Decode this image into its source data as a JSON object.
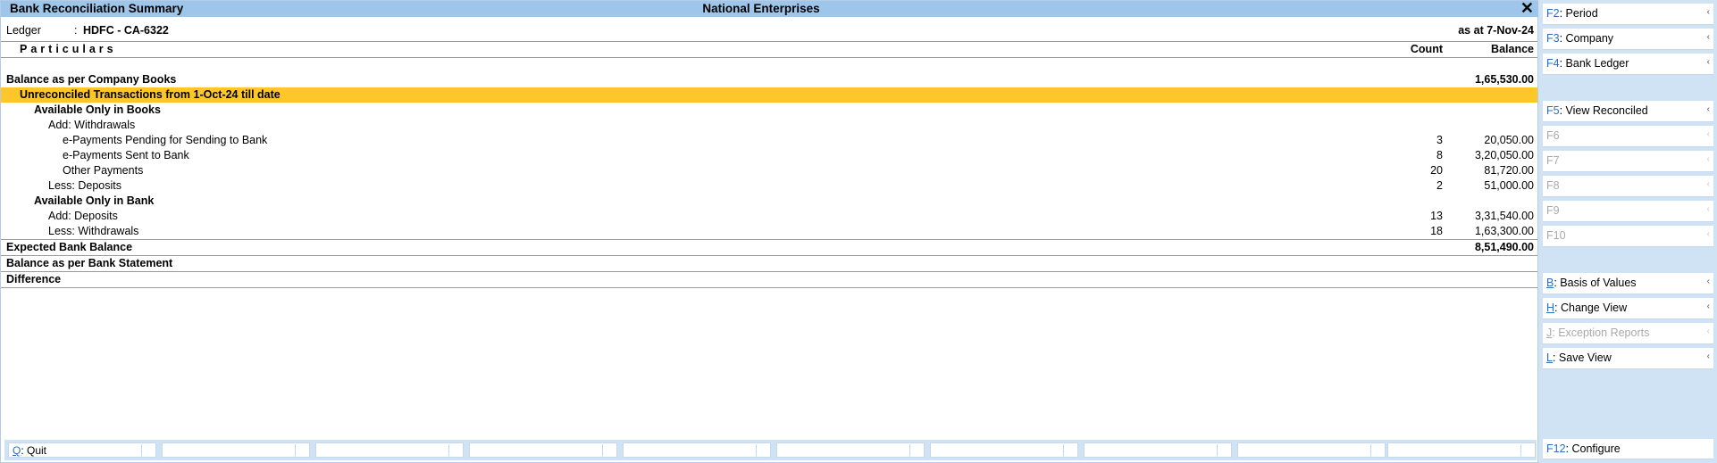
{
  "window": {
    "title": "Bank Reconciliation Summary",
    "company": "National Enterprises",
    "close": "✕"
  },
  "ledger": {
    "label": "Ledger",
    "colon": ":",
    "value": "HDFC - CA-6322",
    "as_at": "as at 7-Nov-24"
  },
  "columns": {
    "particulars": "Particulars",
    "count": "Count",
    "balance": "Balance"
  },
  "rows": [
    {
      "label": "Balance as per Company Books",
      "count": "",
      "balance": "1,65,530.00"
    },
    {
      "label": "Unreconciled Transactions from 1-Oct-24 till date",
      "count": "",
      "balance": ""
    },
    {
      "label": "Available Only in Books",
      "count": "",
      "balance": ""
    },
    {
      "label": "Add: Withdrawals",
      "count": "",
      "balance": ""
    },
    {
      "label": "e-Payments Pending for Sending to Bank",
      "count": "3",
      "balance": "20,050.00"
    },
    {
      "label": "e-Payments Sent to Bank",
      "count": "8",
      "balance": "3,20,050.00"
    },
    {
      "label": "Other Payments",
      "count": "20",
      "balance": "81,720.00"
    },
    {
      "label": "Less: Deposits",
      "count": "2",
      "balance": "51,000.00"
    },
    {
      "label": "Available Only in Bank",
      "count": "",
      "balance": ""
    },
    {
      "label": "Add: Deposits",
      "count": "13",
      "balance": "3,31,540.00"
    },
    {
      "label": "Less: Withdrawals",
      "count": "18",
      "balance": "1,63,300.00"
    },
    {
      "label": "Expected Bank Balance",
      "count": "",
      "balance": "8,51,490.00"
    },
    {
      "label": "Balance as per Bank Statement",
      "count": "",
      "balance": ""
    },
    {
      "label": "Difference",
      "count": "",
      "balance": ""
    }
  ],
  "bottom_bar": {
    "quit_key": "Q",
    "quit_label": ": Quit"
  },
  "side_panel": [
    {
      "key": "F2",
      "label": ": Period",
      "enabled": true
    },
    {
      "key": "F3",
      "label": ": Company",
      "enabled": true
    },
    {
      "key": "F4",
      "label": ": Bank Ledger",
      "enabled": true
    },
    {
      "key": "F5",
      "label": ": View Reconciled",
      "enabled": true
    },
    {
      "key": "F6",
      "label": "",
      "enabled": false
    },
    {
      "key": "F7",
      "label": "",
      "enabled": false
    },
    {
      "key": "F8",
      "label": "",
      "enabled": false
    },
    {
      "key": "F9",
      "label": "",
      "enabled": false
    },
    {
      "key": "F10",
      "label": "",
      "enabled": false
    },
    {
      "key": "B",
      "label": ": Basis of Values",
      "enabled": true
    },
    {
      "key": "H",
      "label": ": Change View",
      "enabled": true
    },
    {
      "key": "J",
      "label": ": Exception Reports",
      "enabled": false
    },
    {
      "key": "L",
      "label": ": Save View",
      "enabled": true
    },
    {
      "key": "F12",
      "label": ": Configure",
      "enabled": true
    }
  ],
  "colors": {
    "title_bg": "#9ec5ea",
    "highlight": "#fdc72c",
    "panel_bg": "#cfe3f4",
    "key_blue": "#2a6fc0"
  }
}
